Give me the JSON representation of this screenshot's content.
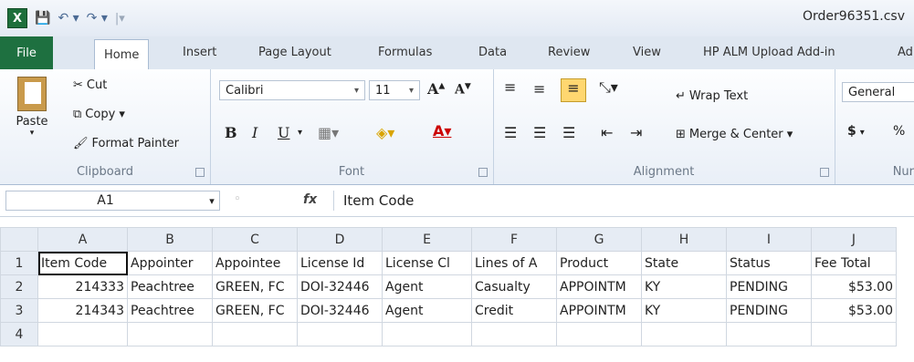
{
  "title_bar": {
    "document_title": "Order96351.csv"
  },
  "tabs": [
    "File",
    "Home",
    "Insert",
    "Page Layout",
    "Formulas",
    "Data",
    "Review",
    "View",
    "HP ALM Upload Add-in",
    "Ad"
  ],
  "ribbon": {
    "clipboard": {
      "paste": "Paste",
      "cut": "Cut",
      "copy": "Copy ▾",
      "format_painter": "Format Painter",
      "label": "Clipboard"
    },
    "font": {
      "family": "Calibri",
      "size": "11",
      "bold": "B",
      "italic": "I",
      "underline": "U",
      "label": "Font"
    },
    "alignment": {
      "wrap_text": "Wrap Text",
      "merge_center": "Merge & Center ▾",
      "label": "Alignment"
    },
    "number": {
      "format": "General",
      "currency": "$",
      "percent": "%",
      "label": "Nur"
    }
  },
  "formula_bar": {
    "name_box": "A1",
    "fx": "fx",
    "formula": "Item Code"
  },
  "sheet": {
    "columns": [
      "A",
      "B",
      "C",
      "D",
      "E",
      "F",
      "G",
      "H",
      "I",
      "J"
    ],
    "rows": [
      [
        "1",
        "Item Code",
        "Appointer",
        "Appointee",
        "License Id",
        "License Cl",
        "Lines of A",
        "Product",
        "State",
        "Status",
        "Fee Total"
      ],
      [
        "2",
        "214333",
        "Peachtree",
        "GREEN, FC",
        "DOI-32446",
        "Agent",
        "Casualty",
        "APPOINTM",
        "KY",
        "PENDING",
        "$53.00"
      ],
      [
        "3",
        "214343",
        "Peachtree",
        "GREEN, FC",
        "DOI-32446",
        "Agent",
        "Credit",
        "APPOINTM",
        "KY",
        "PENDING",
        "$53.00"
      ],
      [
        "4",
        "",
        "",
        "",
        "",
        "",
        "",
        "",
        "",
        "",
        ""
      ]
    ]
  }
}
